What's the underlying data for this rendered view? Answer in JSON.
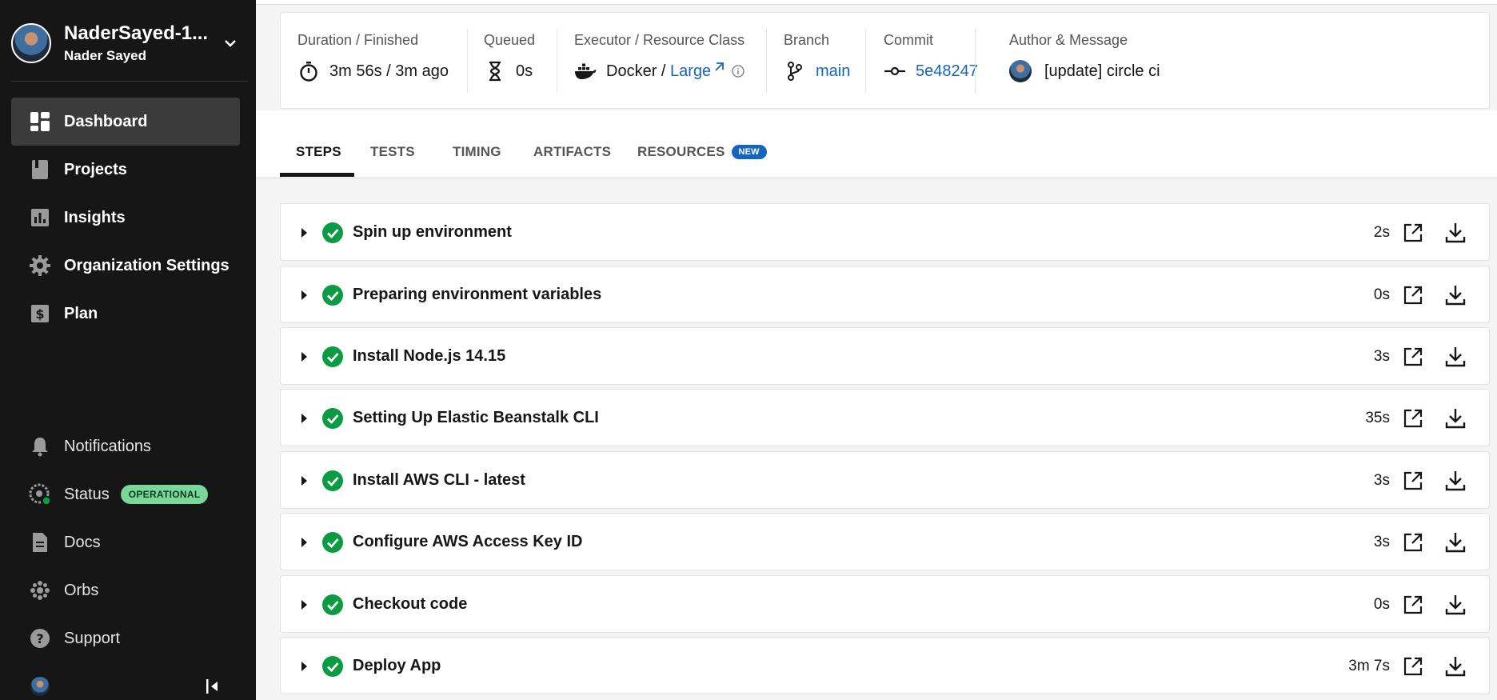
{
  "sidebar": {
    "org_name": "NaderSayed-1...",
    "user_name": "Nader Sayed",
    "primary": [
      {
        "label": "Dashboard",
        "icon": "dashboard-icon",
        "active": true
      },
      {
        "label": "Projects",
        "icon": "book-icon"
      },
      {
        "label": "Insights",
        "icon": "bar-chart-icon"
      },
      {
        "label": "Organization Settings",
        "icon": "gear-icon"
      },
      {
        "label": "Plan",
        "icon": "dollar-icon"
      }
    ],
    "secondary": [
      {
        "label": "Notifications",
        "icon": "bell-icon"
      },
      {
        "label": "Status",
        "icon": "status-gauge-icon",
        "badge": "OPERATIONAL"
      },
      {
        "label": "Docs",
        "icon": "document-icon"
      },
      {
        "label": "Orbs",
        "icon": "orbs-icon"
      },
      {
        "label": "Support",
        "icon": "help-icon"
      }
    ]
  },
  "header": {
    "duration": {
      "label": "Duration / Finished",
      "value": "3m 56s / 3m ago",
      "icon": "stopwatch-icon"
    },
    "queued": {
      "label": "Queued",
      "value": "0s",
      "icon": "hourglass-icon"
    },
    "executor": {
      "label": "Executor / Resource Class",
      "value": "Docker / ",
      "resource": "Large",
      "icon": "docker-icon"
    },
    "branch": {
      "label": "Branch",
      "value": "main",
      "icon": "git-branch-icon"
    },
    "commit": {
      "label": "Commit",
      "value": "5e48247",
      "icon": "git-commit-icon"
    },
    "author": {
      "label": "Author & Message",
      "value": "[update] circle ci"
    }
  },
  "tabs": [
    {
      "label": "STEPS",
      "active": true
    },
    {
      "label": "TESTS"
    },
    {
      "label": "TIMING"
    },
    {
      "label": "ARTIFACTS"
    },
    {
      "label": "RESOURCES",
      "badge": "NEW"
    }
  ],
  "steps": [
    {
      "name": "Spin up environment",
      "duration": "2s",
      "status": "success"
    },
    {
      "name": "Preparing environment variables",
      "duration": "0s",
      "status": "success"
    },
    {
      "name": "Install Node.js 14.15",
      "duration": "3s",
      "status": "success"
    },
    {
      "name": "Setting Up Elastic Beanstalk CLI",
      "duration": "35s",
      "status": "success"
    },
    {
      "name": "Install AWS CLI - latest",
      "duration": "3s",
      "status": "success"
    },
    {
      "name": "Configure AWS Access Key ID",
      "duration": "3s",
      "status": "success"
    },
    {
      "name": "Checkout code",
      "duration": "0s",
      "status": "success"
    },
    {
      "name": "Deploy App",
      "duration": "3m 7s",
      "status": "success"
    }
  ],
  "colors": {
    "accent": "#1565c0",
    "success": "#0a9b43",
    "sidebar_bg": "#161616",
    "operational": "#7bd69a"
  }
}
